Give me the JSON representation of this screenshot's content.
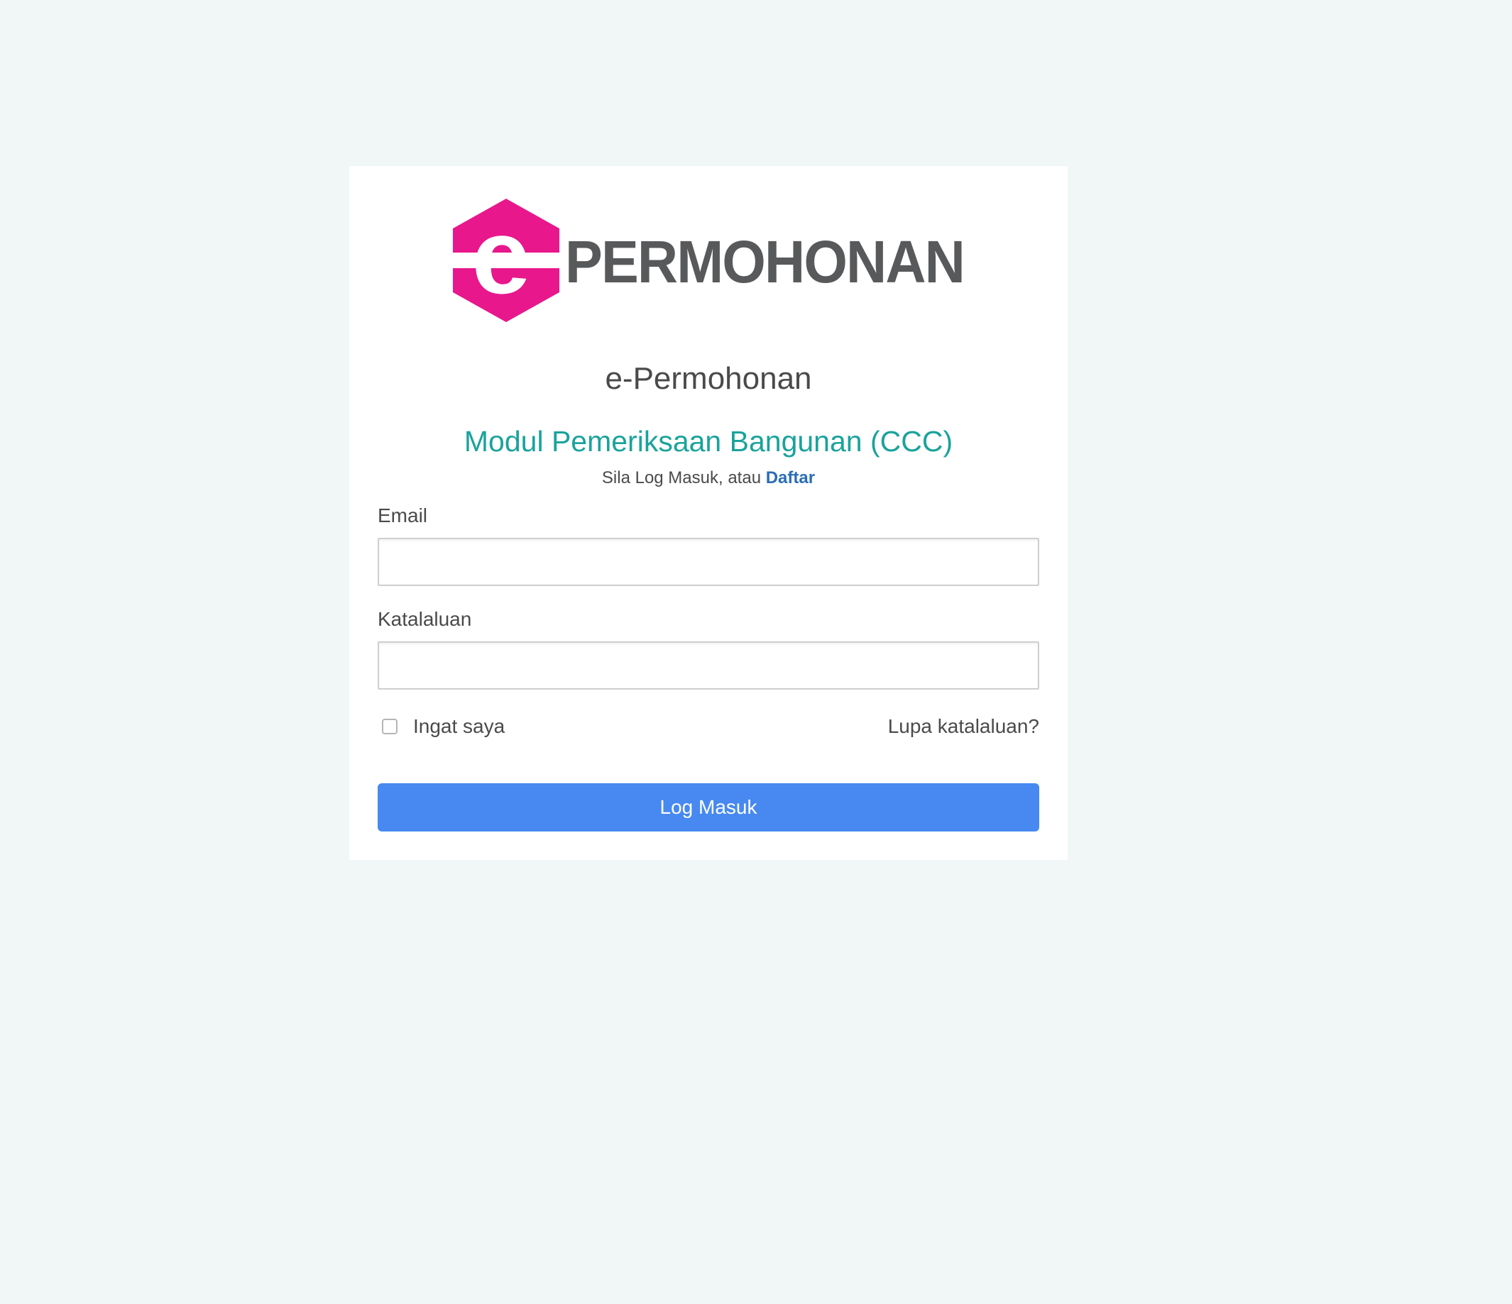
{
  "logo": {
    "letter": "e",
    "wordmark": "PERMOHONAN",
    "hex_color": "#e8178c",
    "text_color": "#58595b"
  },
  "app_title": "e-Permohonan",
  "module_title": "Modul Pemeriksaan Bangunan (CCC)",
  "subtitle": {
    "prefix": "Sila Log Masuk, atau",
    "register_link": "Daftar"
  },
  "form": {
    "email_label": "Email",
    "email_value": "",
    "password_label": "Katalaluan",
    "password_value": "",
    "remember_label": "Ingat saya",
    "remember_checked": false,
    "forgot_link": "Lupa katalaluan?",
    "submit_label": "Log Masuk"
  },
  "colors": {
    "background": "#f1f7f7",
    "module_title": "#1aa39c",
    "link": "#2a6db6",
    "button": "#4789f0"
  }
}
